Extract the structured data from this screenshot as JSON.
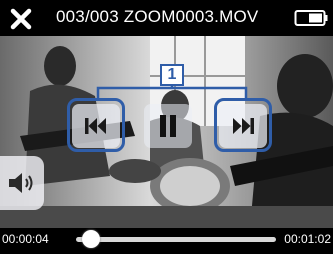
{
  "header": {
    "title": "003/003 ZOOM0003.MOV",
    "close_icon": "close-icon",
    "battery_icon": "battery-icon"
  },
  "controls": {
    "prev_icon": "skip-previous-icon",
    "pause_icon": "pause-icon",
    "next_icon": "skip-next-icon",
    "volume_icon": "volume-icon"
  },
  "callout": {
    "label": "1",
    "color": "#2f5da8"
  },
  "playback": {
    "current_time": "00:00:04",
    "total_time": "00:01:02",
    "progress": 0.065
  }
}
